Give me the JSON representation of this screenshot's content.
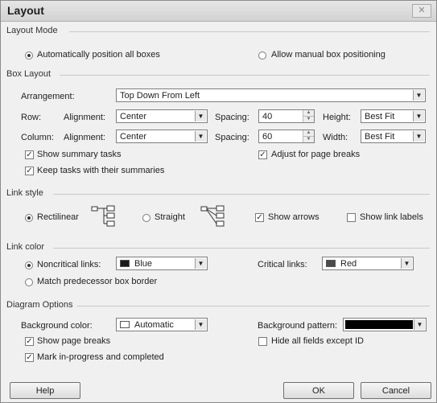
{
  "title": "Layout",
  "close_symbol": "✕",
  "layout_mode": {
    "label": "Layout Mode",
    "auto_label": "Automatically position all boxes",
    "manual_label": "Allow manual box positioning",
    "selected": "auto"
  },
  "box_layout": {
    "label": "Box Layout",
    "arrangement_label": "Arrangement:",
    "arrangement_value": "Top Down From Left",
    "row_label": "Row:",
    "column_label": "Column:",
    "alignment_label": "Alignment:",
    "row_alignment": "Center",
    "column_alignment": "Center",
    "spacing_label": "Spacing:",
    "row_spacing": "40",
    "column_spacing": "60",
    "height_label": "Height:",
    "height_value": "Best Fit",
    "width_label": "Width:",
    "width_value": "Best Fit",
    "show_summary_label": "Show summary tasks",
    "keep_tasks_label": "Keep tasks with their summaries",
    "adjust_breaks_label": "Adjust for page breaks"
  },
  "link_style": {
    "label": "Link style",
    "rectilinear_label": "Rectilinear",
    "straight_label": "Straight",
    "show_arrows_label": "Show arrows",
    "show_link_labels_label": "Show link labels",
    "selected": "rectilinear"
  },
  "link_color": {
    "label": "Link color",
    "noncritical_label": "Noncritical links:",
    "noncritical_value": "Blue",
    "noncritical_color": "#1a1a1a",
    "critical_label": "Critical links:",
    "critical_value": "Red",
    "critical_color": "#4a4a4a",
    "match_label": "Match predecessor box border"
  },
  "diagram_options": {
    "label": "Diagram Options",
    "bg_color_label": "Background color:",
    "bg_color_value": "Automatic",
    "bg_pattern_label": "Background pattern:",
    "bg_pattern_color": "#000000",
    "show_page_breaks_label": "Show page breaks",
    "mark_progress_label": "Mark in-progress and completed",
    "hide_fields_label": "Hide all fields except ID"
  },
  "buttons": {
    "help": "Help",
    "ok": "OK",
    "cancel": "Cancel"
  }
}
